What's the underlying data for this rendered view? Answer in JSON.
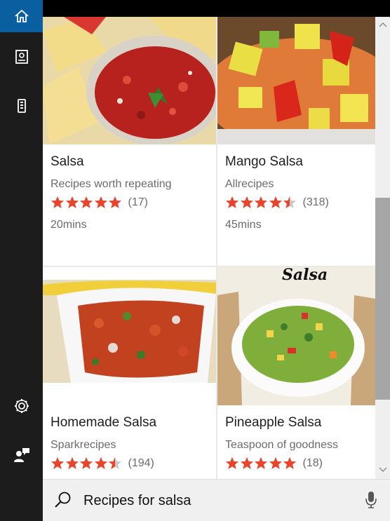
{
  "sidebar": {
    "items": [
      {
        "icon": "home-icon",
        "active": true
      },
      {
        "icon": "notebook-icon"
      },
      {
        "icon": "devices-icon"
      },
      {
        "icon": "settings-gear-icon"
      },
      {
        "icon": "feedback-icon"
      }
    ]
  },
  "recipes": [
    {
      "title": "Salsa",
      "source": "Recipes worth repeating",
      "rating": 5,
      "count": "(17)",
      "time": "20mins"
    },
    {
      "title": "Mango Salsa",
      "source": "Allrecipes",
      "rating": 4.5,
      "count": "(318)",
      "time": "45mins"
    },
    {
      "title": "Homemade Salsa",
      "source": "Sparkrecipes",
      "rating": 4.5,
      "count": "(194)",
      "time": ""
    },
    {
      "title": "Pineapple Salsa",
      "source": "Teaspoon of goodness",
      "rating": 5,
      "count": "(18)",
      "time": "",
      "image_text": "Salsa"
    }
  ],
  "search": {
    "value": "Recipes for salsa",
    "placeholder": ""
  },
  "colors": {
    "accent": "#0a5fa0",
    "star": "#e8452c",
    "star_empty": "#c8c8c8"
  }
}
